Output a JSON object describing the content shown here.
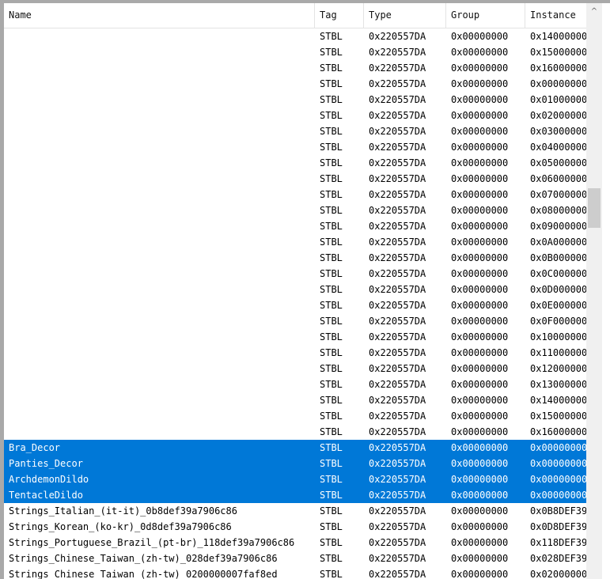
{
  "columns": {
    "name": "Name",
    "tag": "Tag",
    "type": "Type",
    "group": "Group",
    "instance": "Instance"
  },
  "rows": [
    {
      "name": "",
      "tag": "STBL",
      "type": "0x220557DA",
      "group": "0x00000000",
      "instance": "0x14000000",
      "selected": false
    },
    {
      "name": "",
      "tag": "STBL",
      "type": "0x220557DA",
      "group": "0x00000000",
      "instance": "0x15000000",
      "selected": false
    },
    {
      "name": "",
      "tag": "STBL",
      "type": "0x220557DA",
      "group": "0x00000000",
      "instance": "0x16000000",
      "selected": false
    },
    {
      "name": "",
      "tag": "STBL",
      "type": "0x220557DA",
      "group": "0x00000000",
      "instance": "0x00000000",
      "selected": false
    },
    {
      "name": "",
      "tag": "STBL",
      "type": "0x220557DA",
      "group": "0x00000000",
      "instance": "0x01000000",
      "selected": false
    },
    {
      "name": "",
      "tag": "STBL",
      "type": "0x220557DA",
      "group": "0x00000000",
      "instance": "0x02000000",
      "selected": false
    },
    {
      "name": "",
      "tag": "STBL",
      "type": "0x220557DA",
      "group": "0x00000000",
      "instance": "0x03000000",
      "selected": false
    },
    {
      "name": "",
      "tag": "STBL",
      "type": "0x220557DA",
      "group": "0x00000000",
      "instance": "0x04000000",
      "selected": false
    },
    {
      "name": "",
      "tag": "STBL",
      "type": "0x220557DA",
      "group": "0x00000000",
      "instance": "0x05000000",
      "selected": false
    },
    {
      "name": "",
      "tag": "STBL",
      "type": "0x220557DA",
      "group": "0x00000000",
      "instance": "0x06000000",
      "selected": false
    },
    {
      "name": "",
      "tag": "STBL",
      "type": "0x220557DA",
      "group": "0x00000000",
      "instance": "0x07000000",
      "selected": false
    },
    {
      "name": "",
      "tag": "STBL",
      "type": "0x220557DA",
      "group": "0x00000000",
      "instance": "0x08000000",
      "selected": false
    },
    {
      "name": "",
      "tag": "STBL",
      "type": "0x220557DA",
      "group": "0x00000000",
      "instance": "0x09000000",
      "selected": false
    },
    {
      "name": "",
      "tag": "STBL",
      "type": "0x220557DA",
      "group": "0x00000000",
      "instance": "0x0A000000",
      "selected": false
    },
    {
      "name": "",
      "tag": "STBL",
      "type": "0x220557DA",
      "group": "0x00000000",
      "instance": "0x0B000000",
      "selected": false
    },
    {
      "name": "",
      "tag": "STBL",
      "type": "0x220557DA",
      "group": "0x00000000",
      "instance": "0x0C000000",
      "selected": false
    },
    {
      "name": "",
      "tag": "STBL",
      "type": "0x220557DA",
      "group": "0x00000000",
      "instance": "0x0D000000",
      "selected": false
    },
    {
      "name": "",
      "tag": "STBL",
      "type": "0x220557DA",
      "group": "0x00000000",
      "instance": "0x0E000000",
      "selected": false
    },
    {
      "name": "",
      "tag": "STBL",
      "type": "0x220557DA",
      "group": "0x00000000",
      "instance": "0x0F000000",
      "selected": false
    },
    {
      "name": "",
      "tag": "STBL",
      "type": "0x220557DA",
      "group": "0x00000000",
      "instance": "0x10000000",
      "selected": false
    },
    {
      "name": "",
      "tag": "STBL",
      "type": "0x220557DA",
      "group": "0x00000000",
      "instance": "0x11000000",
      "selected": false
    },
    {
      "name": "",
      "tag": "STBL",
      "type": "0x220557DA",
      "group": "0x00000000",
      "instance": "0x12000000",
      "selected": false
    },
    {
      "name": "",
      "tag": "STBL",
      "type": "0x220557DA",
      "group": "0x00000000",
      "instance": "0x13000000",
      "selected": false
    },
    {
      "name": "",
      "tag": "STBL",
      "type": "0x220557DA",
      "group": "0x00000000",
      "instance": "0x14000000",
      "selected": false
    },
    {
      "name": "",
      "tag": "STBL",
      "type": "0x220557DA",
      "group": "0x00000000",
      "instance": "0x15000000",
      "selected": false
    },
    {
      "name": "",
      "tag": "STBL",
      "type": "0x220557DA",
      "group": "0x00000000",
      "instance": "0x16000000",
      "selected": false
    },
    {
      "name": "Bra_Decor",
      "tag": "STBL",
      "type": "0x220557DA",
      "group": "0x00000000",
      "instance": "0x00000000",
      "selected": true
    },
    {
      "name": "Panties_Decor",
      "tag": "STBL",
      "type": "0x220557DA",
      "group": "0x00000000",
      "instance": "0x00000000",
      "selected": true
    },
    {
      "name": "ArchdemonDildo",
      "tag": "STBL",
      "type": "0x220557DA",
      "group": "0x00000000",
      "instance": "0x00000000",
      "selected": true
    },
    {
      "name": "TentacleDildo",
      "tag": "STBL",
      "type": "0x220557DA",
      "group": "0x00000000",
      "instance": "0x00000000",
      "selected": true
    },
    {
      "name": "Strings_Italian_(it-it)_0b8def39a7906c86",
      "tag": "STBL",
      "type": "0x220557DA",
      "group": "0x00000000",
      "instance": "0x0B8DEF39",
      "selected": false
    },
    {
      "name": "Strings_Korean_(ko-kr)_0d8def39a7906c86",
      "tag": "STBL",
      "type": "0x220557DA",
      "group": "0x00000000",
      "instance": "0x0D8DEF39",
      "selected": false
    },
    {
      "name": "Strings_Portuguese_Brazil_(pt-br)_118def39a7906c86",
      "tag": "STBL",
      "type": "0x220557DA",
      "group": "0x00000000",
      "instance": "0x118DEF39",
      "selected": false
    },
    {
      "name": "Strings_Chinese_Taiwan_(zh-tw)_028def39a7906c86",
      "tag": "STBL",
      "type": "0x220557DA",
      "group": "0x00000000",
      "instance": "0x028DEF39",
      "selected": false
    },
    {
      "name": "Strings_Chinese_Taiwan_(zh-tw)_0200000007faf8ed",
      "tag": "STBL",
      "type": "0x220557DA",
      "group": "0x00000000",
      "instance": "0x02000000",
      "selected": false
    }
  ],
  "scrollbar": {
    "up_arrow": "^"
  },
  "colors": {
    "selection": "#0078d7",
    "selection_text": "#ffffff",
    "window_border": "#a9a9a9"
  }
}
